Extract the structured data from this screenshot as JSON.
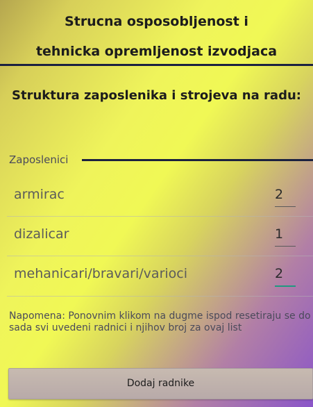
{
  "header": {
    "title_line1": "Strucna osposobljenost i",
    "title_line2": "tehnicka opremljenost izvodjaca"
  },
  "subtitle": "Struktura zaposlenika i strojeva na radu:",
  "section": {
    "label": "Zaposlenici"
  },
  "employees": [
    {
      "label": "armirac",
      "value": "2"
    },
    {
      "label": "dizalicar",
      "value": "1"
    },
    {
      "label": "mehanicari/bravari/varioci",
      "value": "2"
    }
  ],
  "note": "Napomena: Ponovnim klikom na dugme ispod resetiraju se do sada svi uvedeni radnici i njihov broj za ovaj list",
  "button": {
    "label": "Dodaj radnike"
  },
  "colors": {
    "rule": "#1b2140",
    "focus_underline": "#1f9980"
  }
}
